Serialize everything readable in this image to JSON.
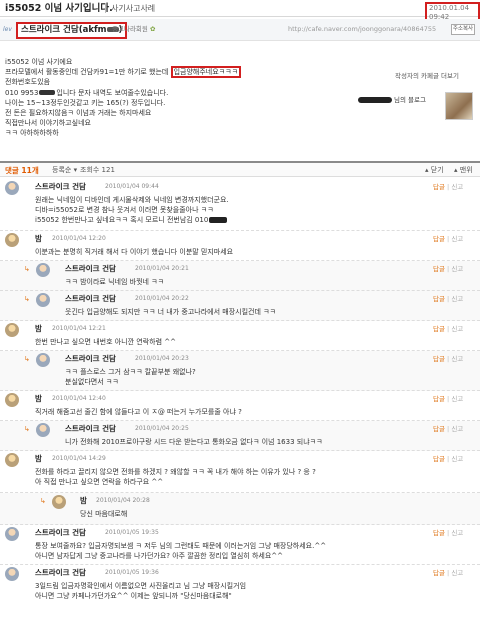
{
  "post": {
    "title": "i55052 이넘 사기입니다.",
    "category": "사기사고사례",
    "date": "2010.01.04 09:42",
    "author": "스트라이크 건담(akfm",
    "author_suffix": ")",
    "author_grade": "중고나라회원",
    "cafe_url": "http://cafe.naver.com/joonggonara/40864755",
    "copy_label": "주소복사",
    "body": {
      "line1": "i55052 이넘 사기에요",
      "line2_pre": "프라모델에서 활동중인데 건담카91=1만 하기로 했는데",
      "line2_hl": "입금양해주네요ㅋㅋㅋ",
      "line3": "전화번호도있음",
      "line4_pre": "010 9953",
      "line4_post": "입니다 문자 내역도 보여줄수있습니다.",
      "line5": "나이는 15~13정두인것같고 키는 165(?) 정두입니다.",
      "line6": "전 돈은 필요하지않음ㅋ 이넘과 거래는 하지마세요",
      "line7": "직접만나서 이야기하고싶네요",
      "line8": "ㅋㅋ 아하하하하하"
    },
    "blog_link": "작성자의 카페글 더보기",
    "blog_name": "님의 블로그"
  },
  "comment_bar": {
    "count": "댓글 11개",
    "order": "등록순",
    "views": "조회수 121",
    "close": "닫기",
    "top": "맨위"
  },
  "actions": {
    "reply": "답글",
    "report": "신고"
  },
  "comments": [
    {
      "author": "스트라이크 건담",
      "date": "2010/01/04 09:44",
      "lines": [
        "원래는 닉네임이 디바인데 게시물삭제와 닉네임 변경까지했더군요.",
        "디바=i55052로 변경 참나 웃겨서 이러면 못찾을줄아나 ㅋㅋ",
        "i55052 한번만나고 싶네요ㅋㅋ 혹시 모르니 전번남김 010"
      ]
    },
    {
      "author": "밤",
      "date": "2010/01/04 12:20",
      "lines": [
        "이분과는 분명히 직거래 해서 다 이야기 했습니다 이분말 믿지마세요"
      ]
    },
    {
      "author": "스트라이크 건담",
      "date": "2010/01/04 20:21",
      "lines": [
        "ㅋㅋ 밤이라료 닉네임 바꿧네 ㅋㅋ"
      ]
    },
    {
      "author": "스트라이크 건담",
      "date": "2010/01/04 20:22",
      "lines": [
        "웃긴다 입금양해도 되지만 ㅋㅋ 너 내가 중고나라에서 매장시킬건데 ㅋㅋ"
      ]
    },
    {
      "author": "밤",
      "date": "2010/01/04 12:21",
      "lines": [
        "한번 만나고 싶으면 내번호 아니깐 연락하렴 ^^"
      ]
    },
    {
      "author": "스트라이크 건담",
      "date": "2010/01/04 20:23",
      "lines": [
        "ㅋㅋ 플스로스 그거 삼ㅋㅋ 칼끝부분 왜없나?",
        "분실없다면서 ㅋㅋ"
      ]
    },
    {
      "author": "밤",
      "date": "2010/01/04 12:40",
      "lines": [
        "직거래 해줌고선 줄긴 함에 않들다고 이 ㅈ@ 떠는거 누가모를줄 아냐 ?"
      ]
    },
    {
      "author": "스트라이크 건담",
      "date": "2010/01/04 20:25",
      "lines": [
        "니가 전화해 2010프로아구랑 시드 다운 받는다고 통화오금 없다ㅋ 이넘 1633 되냐ㅋㅋ"
      ]
    },
    {
      "author": "밤",
      "date": "2010/01/04 14:29",
      "lines": [
        "전화를 하라고 끌리지 않으면 전화를 하겠지 ? 왜않할 ㅋㅋ 꼭 내가 해야 하는 이유가 있나 ? 응 ?",
        "아 직접 만나고 싶으면 연락을 하라구요 ^^"
      ]
    },
    {
      "author": "밤",
      "date": "2010/01/04 20:28",
      "lines": [
        "당신 마음대로해"
      ]
    },
    {
      "author": "스트라이크 건담",
      "date": "2010/01/05 19:35",
      "lines": [
        "통장 보여줄까요? 입금자명되보셈 ㅋ 저두 님의 그런태도 때문에 이러는거임 그냥 매장당하세요.^^",
        "아니면 남자답게 그냥 중고나라를 나가던가요? 아주 깔끔한 정리입 열심히 하세요^^"
      ]
    },
    {
      "author": "스트라이크 건담",
      "date": "2010/01/05 19:36",
      "lines": [
        "3일드림 입금자명확인에서 이름없으면 사진올리고 님 그냥 매장시킬거임",
        "아니면 그냥 카페나가던가요^^ 이제는 앞되니까 \"당신마음대로해\""
      ]
    }
  ]
}
